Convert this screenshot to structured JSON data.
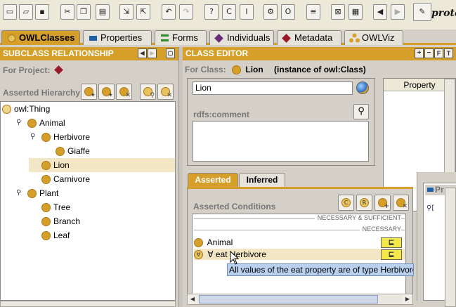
{
  "app": {
    "logo_text": "protégé"
  },
  "toolbar": {
    "buttons": [
      {
        "icon": "new-file-icon",
        "glyph": "▭"
      },
      {
        "icon": "open-folder-icon",
        "glyph": "▱"
      },
      {
        "icon": "save-icon",
        "glyph": "▪"
      },
      {
        "icon": "cut-icon",
        "glyph": "✂"
      },
      {
        "icon": "copy-icon",
        "glyph": "❐"
      },
      {
        "icon": "paste-icon",
        "glyph": "▤"
      },
      {
        "icon": "import-icon",
        "glyph": "⇲"
      },
      {
        "icon": "export-icon",
        "glyph": "⇱"
      },
      {
        "icon": "undo-icon",
        "glyph": "↶"
      },
      {
        "icon": "redo-icon",
        "glyph": "↷"
      },
      {
        "icon": "query-icon",
        "glyph": "?"
      },
      {
        "icon": "class-form-icon",
        "glyph": "C"
      },
      {
        "icon": "instance-form-icon",
        "glyph": "I"
      },
      {
        "icon": "reasoner-icon",
        "glyph": "⚙"
      },
      {
        "icon": "ontology-icon",
        "glyph": "O"
      },
      {
        "icon": "document-icon",
        "glyph": "≡"
      },
      {
        "icon": "close-window-icon",
        "glyph": "⊠"
      },
      {
        "icon": "table-icon",
        "glyph": "▦"
      },
      {
        "icon": "back-icon",
        "glyph": "◀"
      },
      {
        "icon": "forward-icon",
        "glyph": "▶"
      },
      {
        "icon": "pencil-icon",
        "glyph": "✎"
      }
    ]
  },
  "tabs": [
    {
      "label": "OWLClasses",
      "icon": "owl-classes-icon",
      "color": "#d59f2a",
      "active": true
    },
    {
      "label": "Properties",
      "icon": "properties-icon",
      "color": "#1f5fa8",
      "active": false
    },
    {
      "label": "Forms",
      "icon": "forms-icon",
      "color": "#2f8a2f",
      "active": false
    },
    {
      "label": "Individuals",
      "icon": "individuals-icon",
      "color": "#6a2a7a",
      "active": false
    },
    {
      "label": "Metadata",
      "icon": "metadata-icon",
      "color": "#9a1a2a",
      "active": false
    },
    {
      "label": "OWLViz",
      "icon": "owlviz-icon",
      "color": "#d59f2a",
      "active": false
    }
  ],
  "subclass_panel": {
    "title": "SUBCLASS RELATIONSHIP",
    "for_project_label": "For Project:",
    "asserted_hierarchy_label": "Asserted Hierarchy",
    "tree": [
      {
        "label": "owl:Thing",
        "level": 0,
        "expander": "",
        "selected": false,
        "icon_hollow": true
      },
      {
        "label": "Animal",
        "level": 1,
        "expander": "⚲",
        "selected": false
      },
      {
        "label": "Herbivore",
        "level": 2,
        "expander": "⚲",
        "selected": false
      },
      {
        "label": "Giaffe",
        "level": 3,
        "expander": "",
        "selected": false
      },
      {
        "label": "Lion",
        "level": 2,
        "expander": "",
        "selected": true
      },
      {
        "label": "Carnivore",
        "level": 2,
        "expander": "",
        "selected": false
      },
      {
        "label": "Plant",
        "level": 1,
        "expander": "⚲",
        "selected": false
      },
      {
        "label": "Tree",
        "level": 2,
        "expander": "",
        "selected": false
      },
      {
        "label": "Branch",
        "level": 2,
        "expander": "",
        "selected": false
      },
      {
        "label": "Leaf",
        "level": 2,
        "expander": "",
        "selected": false
      }
    ]
  },
  "class_editor": {
    "title": "CLASS EDITOR",
    "for_class_label": "For Class:",
    "class_name": "Lion",
    "instance_of": "(instance of owl:Class)",
    "name_value": "Lion",
    "comment_label": "rdfs:comment",
    "property_header": "Property",
    "subtabs": [
      {
        "label": "Asserted",
        "active": true
      },
      {
        "label": "Inferred",
        "active": false
      }
    ],
    "asserted_conditions_label": "Asserted Conditions",
    "necessary_sufficient": "NECESSARY & SUFFICIENT",
    "necessary": "NECESSARY",
    "conditions": [
      {
        "label": "Animal",
        "symbol": "⊑",
        "selected": false
      },
      {
        "label": "∀ eat Herbivore",
        "symbol": "⊑",
        "selected": true
      }
    ],
    "tooltip": "All values of the eat property are of type Herbivore",
    "side_label": "Pr"
  },
  "colors": {
    "accent": "#d59f2a",
    "selection": "#f2e6c5"
  }
}
